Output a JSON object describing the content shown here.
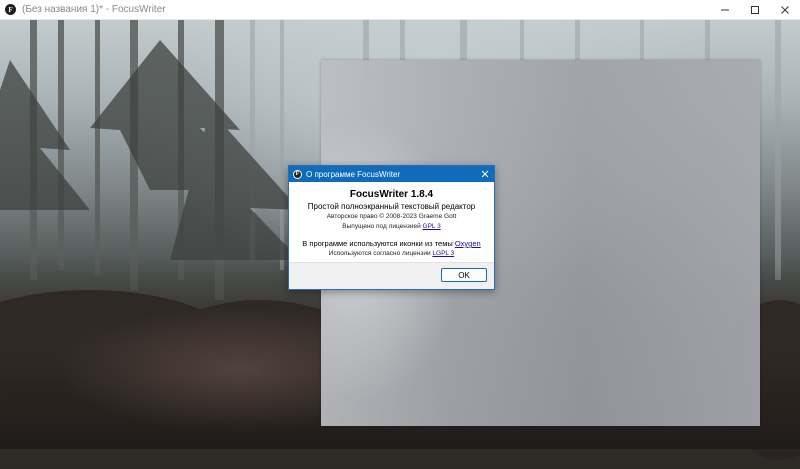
{
  "window": {
    "title": "(Без названия 1)* - FocusWriter",
    "app_icon_letter": "F"
  },
  "about": {
    "title": "О программе FocusWriter",
    "app_name": "FocusWriter 1.8.4",
    "tagline": "Простой полноэкранный текстовый редактор",
    "copyright": "Авторское право © 2008-2023 Graeme Gott",
    "license_prefix": "Выпущено под лицензией",
    "license_link": "GPL 3",
    "icons_prefix": "В программе используются иконки из темы",
    "icons_link": "Oxygen",
    "icons_license_prefix": "Используются согласно лицензии",
    "icons_license_link": "LGPL 3",
    "ok_label": "OK"
  },
  "colors": {
    "dialog_title_bg": "#0f6cbd",
    "link": "#1a0dab"
  }
}
